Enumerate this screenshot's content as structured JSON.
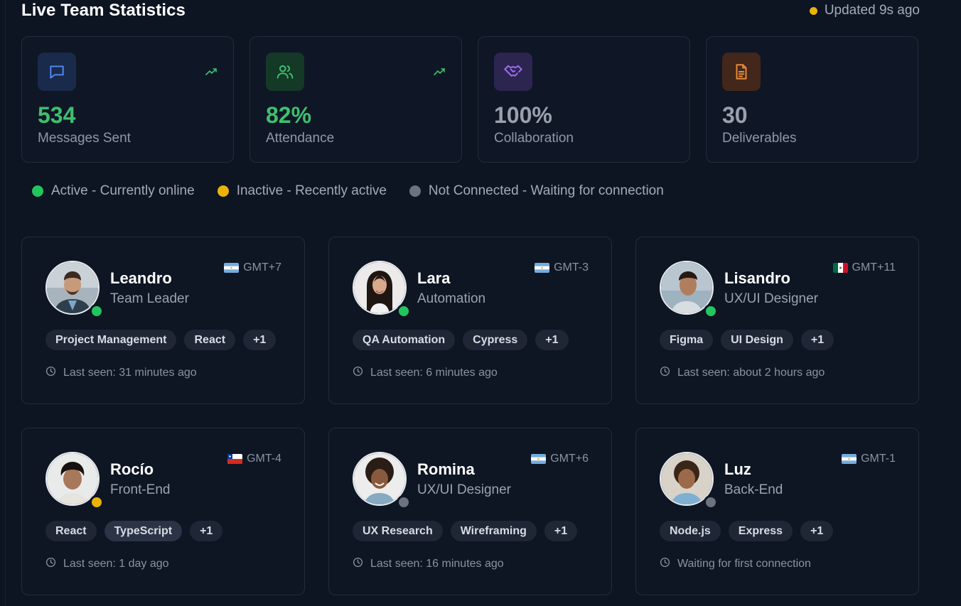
{
  "header": {
    "title": "Live Team Statistics",
    "updated": "Updated 9s ago",
    "updated_color": "#eab308"
  },
  "stats": [
    {
      "value": "534",
      "label": "Messages Sent",
      "icon": "message-square-icon",
      "value_color": "#3fbf6e",
      "trend": true
    },
    {
      "value": "82%",
      "label": "Attendance",
      "icon": "users-icon",
      "value_color": "#3fbf6e",
      "trend": true
    },
    {
      "value": "100%",
      "label": "Collaboration",
      "icon": "handshake-icon",
      "value_color": "#9aa1ad",
      "trend": false
    },
    {
      "value": "30",
      "label": "Deliverables",
      "icon": "file-text-icon",
      "value_color": "#9aa1ad",
      "trend": false
    }
  ],
  "legend": [
    {
      "label": "Active - Currently online",
      "color": "#22c55e"
    },
    {
      "label": "Inactive - Recently active",
      "color": "#eab308"
    },
    {
      "label": "Not Connected - Waiting for connection",
      "color": "#6b7280"
    }
  ],
  "members": [
    {
      "name": "Leandro",
      "role": "Team Leader",
      "timezone": "GMT+7",
      "flag": "argentina-flag",
      "status": "active",
      "tags": [
        "Project Management",
        "React",
        "+1"
      ],
      "last_seen": "Last seen: 31 minutes ago"
    },
    {
      "name": "Lara",
      "role": "Automation",
      "timezone": "GMT-3",
      "flag": "argentina-flag",
      "status": "active",
      "tags": [
        "QA Automation",
        "Cypress",
        "+1"
      ],
      "last_seen": "Last seen: 6 minutes ago"
    },
    {
      "name": "Lisandro",
      "role": "UX/UI Designer",
      "timezone": "GMT+11",
      "flag": "mexico-flag",
      "status": "active",
      "tags": [
        "Figma",
        "UI Design",
        "+1"
      ],
      "last_seen": "Last seen: about 2 hours ago"
    },
    {
      "name": "Rocío",
      "role": "Front-End",
      "timezone": "GMT-4",
      "flag": "chile-flag",
      "status": "inactive",
      "tags": [
        "React",
        "TypeScript",
        "+1"
      ],
      "last_seen": "Last seen: 1 day ago"
    },
    {
      "name": "Romina",
      "role": "UX/UI Designer",
      "timezone": "GMT+6",
      "flag": "argentina-flag",
      "status": "offline",
      "tags": [
        "UX Research",
        "Wireframing",
        "+1"
      ],
      "last_seen": "Last seen: 16 minutes ago"
    },
    {
      "name": "Luz",
      "role": "Back-End",
      "timezone": "GMT-1",
      "flag": "argentina-flag",
      "status": "offline",
      "tags": [
        "Node.js",
        "Express",
        "+1"
      ],
      "last_seen": "Waiting for first connection"
    }
  ]
}
